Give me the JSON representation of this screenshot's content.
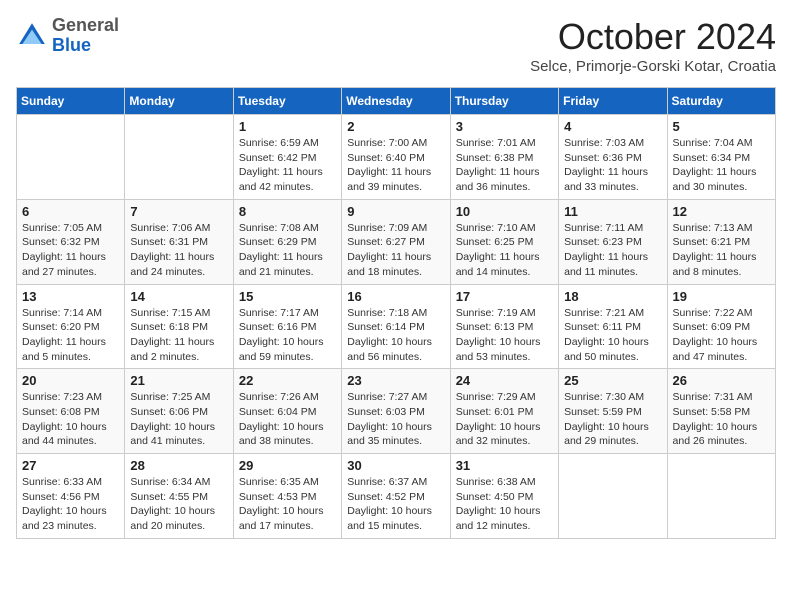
{
  "header": {
    "logo_general": "General",
    "logo_blue": "Blue",
    "month": "October 2024",
    "location": "Selce, Primorje-Gorski Kotar, Croatia"
  },
  "days_of_week": [
    "Sunday",
    "Monday",
    "Tuesday",
    "Wednesday",
    "Thursday",
    "Friday",
    "Saturday"
  ],
  "weeks": [
    [
      {
        "day": "",
        "info": ""
      },
      {
        "day": "",
        "info": ""
      },
      {
        "day": "1",
        "info": "Sunrise: 6:59 AM\nSunset: 6:42 PM\nDaylight: 11 hours and 42 minutes."
      },
      {
        "day": "2",
        "info": "Sunrise: 7:00 AM\nSunset: 6:40 PM\nDaylight: 11 hours and 39 minutes."
      },
      {
        "day": "3",
        "info": "Sunrise: 7:01 AM\nSunset: 6:38 PM\nDaylight: 11 hours and 36 minutes."
      },
      {
        "day": "4",
        "info": "Sunrise: 7:03 AM\nSunset: 6:36 PM\nDaylight: 11 hours and 33 minutes."
      },
      {
        "day": "5",
        "info": "Sunrise: 7:04 AM\nSunset: 6:34 PM\nDaylight: 11 hours and 30 minutes."
      }
    ],
    [
      {
        "day": "6",
        "info": "Sunrise: 7:05 AM\nSunset: 6:32 PM\nDaylight: 11 hours and 27 minutes."
      },
      {
        "day": "7",
        "info": "Sunrise: 7:06 AM\nSunset: 6:31 PM\nDaylight: 11 hours and 24 minutes."
      },
      {
        "day": "8",
        "info": "Sunrise: 7:08 AM\nSunset: 6:29 PM\nDaylight: 11 hours and 21 minutes."
      },
      {
        "day": "9",
        "info": "Sunrise: 7:09 AM\nSunset: 6:27 PM\nDaylight: 11 hours and 18 minutes."
      },
      {
        "day": "10",
        "info": "Sunrise: 7:10 AM\nSunset: 6:25 PM\nDaylight: 11 hours and 14 minutes."
      },
      {
        "day": "11",
        "info": "Sunrise: 7:11 AM\nSunset: 6:23 PM\nDaylight: 11 hours and 11 minutes."
      },
      {
        "day": "12",
        "info": "Sunrise: 7:13 AM\nSunset: 6:21 PM\nDaylight: 11 hours and 8 minutes."
      }
    ],
    [
      {
        "day": "13",
        "info": "Sunrise: 7:14 AM\nSunset: 6:20 PM\nDaylight: 11 hours and 5 minutes."
      },
      {
        "day": "14",
        "info": "Sunrise: 7:15 AM\nSunset: 6:18 PM\nDaylight: 11 hours and 2 minutes."
      },
      {
        "day": "15",
        "info": "Sunrise: 7:17 AM\nSunset: 6:16 PM\nDaylight: 10 hours and 59 minutes."
      },
      {
        "day": "16",
        "info": "Sunrise: 7:18 AM\nSunset: 6:14 PM\nDaylight: 10 hours and 56 minutes."
      },
      {
        "day": "17",
        "info": "Sunrise: 7:19 AM\nSunset: 6:13 PM\nDaylight: 10 hours and 53 minutes."
      },
      {
        "day": "18",
        "info": "Sunrise: 7:21 AM\nSunset: 6:11 PM\nDaylight: 10 hours and 50 minutes."
      },
      {
        "day": "19",
        "info": "Sunrise: 7:22 AM\nSunset: 6:09 PM\nDaylight: 10 hours and 47 minutes."
      }
    ],
    [
      {
        "day": "20",
        "info": "Sunrise: 7:23 AM\nSunset: 6:08 PM\nDaylight: 10 hours and 44 minutes."
      },
      {
        "day": "21",
        "info": "Sunrise: 7:25 AM\nSunset: 6:06 PM\nDaylight: 10 hours and 41 minutes."
      },
      {
        "day": "22",
        "info": "Sunrise: 7:26 AM\nSunset: 6:04 PM\nDaylight: 10 hours and 38 minutes."
      },
      {
        "day": "23",
        "info": "Sunrise: 7:27 AM\nSunset: 6:03 PM\nDaylight: 10 hours and 35 minutes."
      },
      {
        "day": "24",
        "info": "Sunrise: 7:29 AM\nSunset: 6:01 PM\nDaylight: 10 hours and 32 minutes."
      },
      {
        "day": "25",
        "info": "Sunrise: 7:30 AM\nSunset: 5:59 PM\nDaylight: 10 hours and 29 minutes."
      },
      {
        "day": "26",
        "info": "Sunrise: 7:31 AM\nSunset: 5:58 PM\nDaylight: 10 hours and 26 minutes."
      }
    ],
    [
      {
        "day": "27",
        "info": "Sunrise: 6:33 AM\nSunset: 4:56 PM\nDaylight: 10 hours and 23 minutes."
      },
      {
        "day": "28",
        "info": "Sunrise: 6:34 AM\nSunset: 4:55 PM\nDaylight: 10 hours and 20 minutes."
      },
      {
        "day": "29",
        "info": "Sunrise: 6:35 AM\nSunset: 4:53 PM\nDaylight: 10 hours and 17 minutes."
      },
      {
        "day": "30",
        "info": "Sunrise: 6:37 AM\nSunset: 4:52 PM\nDaylight: 10 hours and 15 minutes."
      },
      {
        "day": "31",
        "info": "Sunrise: 6:38 AM\nSunset: 4:50 PM\nDaylight: 10 hours and 12 minutes."
      },
      {
        "day": "",
        "info": ""
      },
      {
        "day": "",
        "info": ""
      }
    ]
  ]
}
